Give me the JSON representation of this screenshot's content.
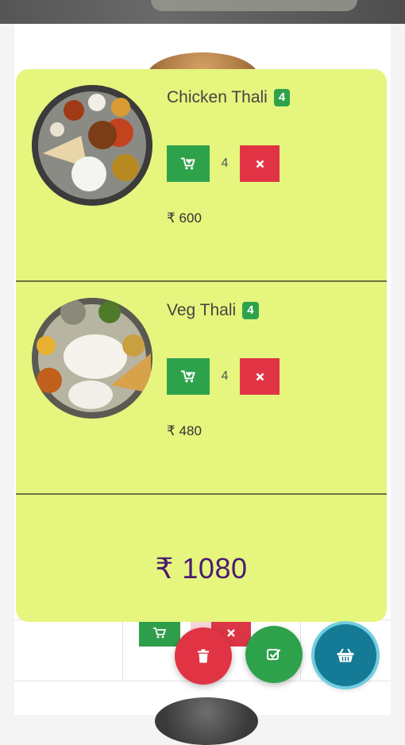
{
  "colors": {
    "panel_bg": "#e6f57d",
    "add_green": "#2ea24b",
    "remove_red": "#e03445",
    "total_purple": "#4b1a73",
    "basket_teal": "#157a96"
  },
  "cart": {
    "items": [
      {
        "name": "Chicken Thali",
        "badge": "4",
        "quantity": "4",
        "price": "₹ 600"
      },
      {
        "name": "Veg Thali",
        "badge": "4",
        "quantity": "4",
        "price": "₹ 480"
      }
    ],
    "total": "₹ 1080"
  },
  "icons": {
    "add": "cart-plus-icon",
    "remove": "close-icon",
    "clear": "trash-icon",
    "checkout": "check-square-icon",
    "basket": "basket-icon"
  }
}
